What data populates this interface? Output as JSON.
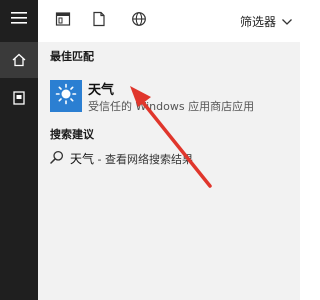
{
  "toolbar": {
    "filter_label": "筛选器"
  },
  "sections": {
    "best_match_title": "最佳匹配",
    "search_suggestions_title": "搜索建议"
  },
  "best_match": {
    "app_name": "天气",
    "app_description": "受信任的 Windows 应用商店应用"
  },
  "suggestion": {
    "query": "天气",
    "hint": " - 查看网络搜索结果"
  },
  "colors": {
    "rail": "#1f1f1f",
    "panel": "#f2f2f2",
    "app_tile": "#2b7fd2",
    "annotation_arrow": "#e0362c"
  }
}
